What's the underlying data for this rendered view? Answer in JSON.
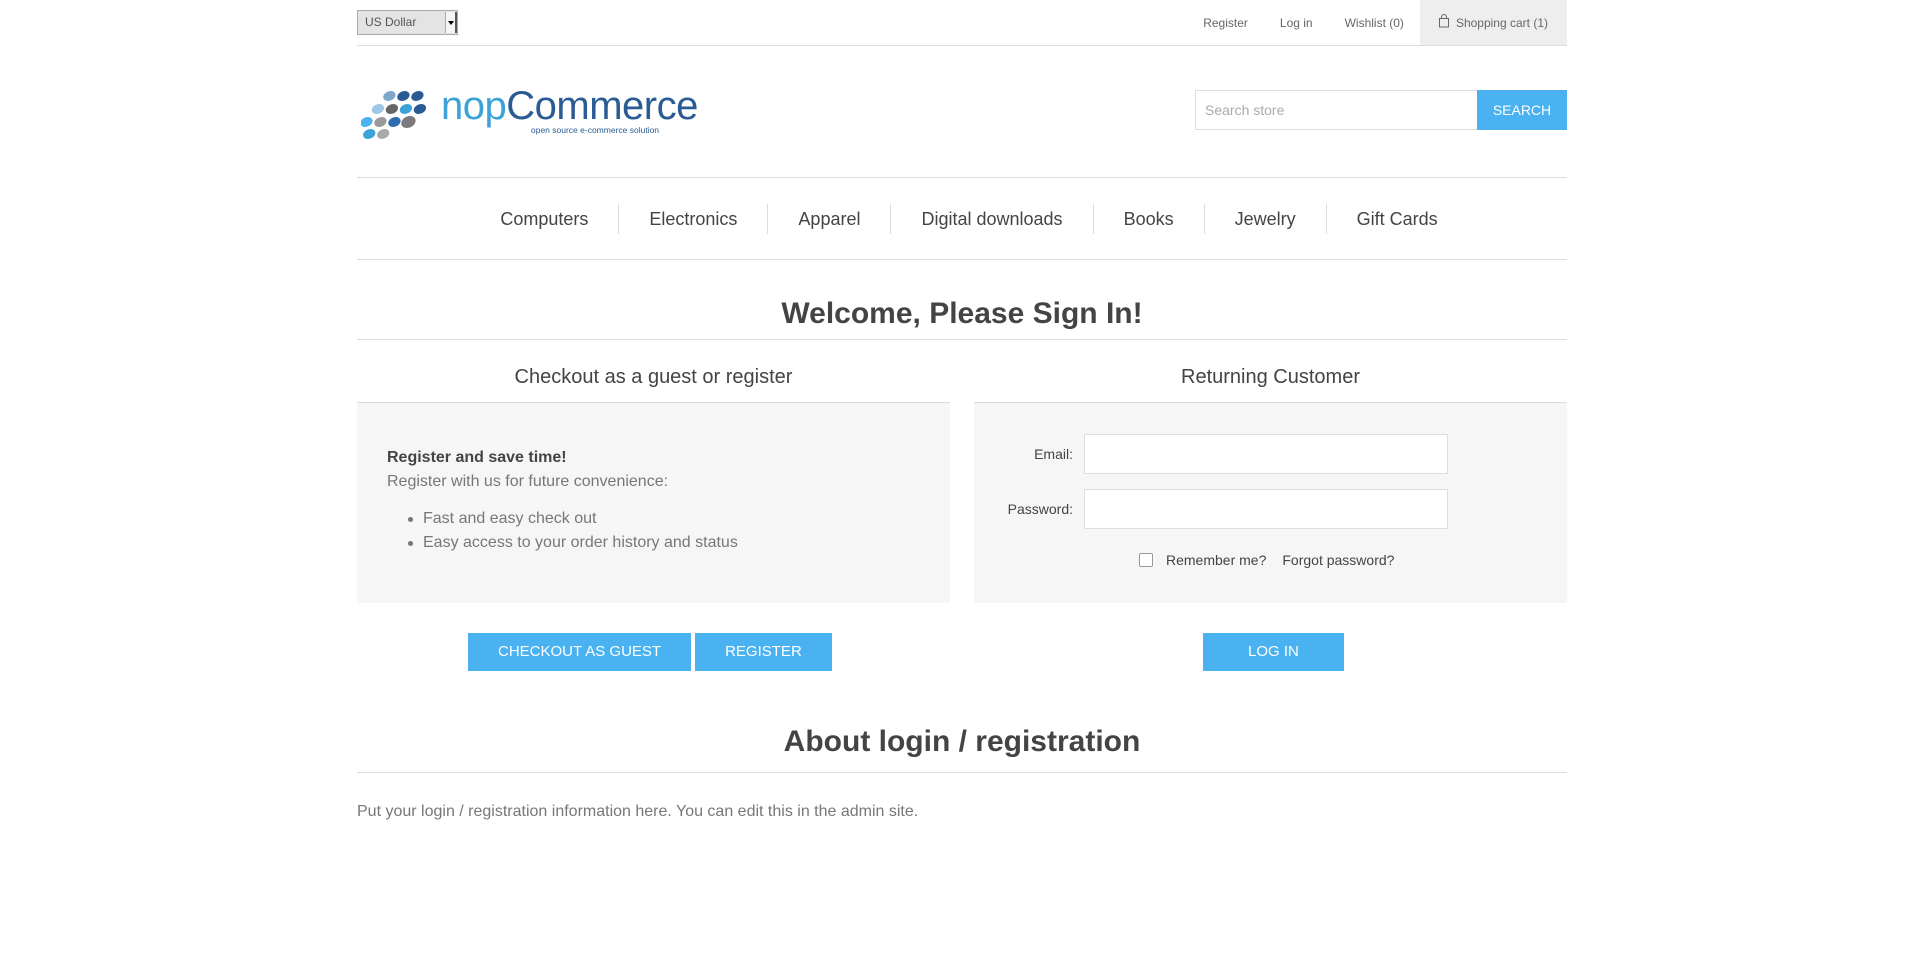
{
  "header": {
    "currency": "US Dollar",
    "links": {
      "register": "Register",
      "login": "Log in",
      "wishlist": "Wishlist (0)",
      "cart": "Shopping cart (1)"
    }
  },
  "logo": {
    "name_part1": "nop",
    "name_part2": "Commerce",
    "tagline": "open source e-commerce solution"
  },
  "search": {
    "placeholder": "Search store",
    "button": "SEARCH"
  },
  "menu": {
    "items": [
      "Computers",
      "Electronics",
      "Apparel",
      "Digital downloads",
      "Books",
      "Jewelry",
      "Gift Cards"
    ]
  },
  "page": {
    "title": "Welcome, Please Sign In!"
  },
  "guest": {
    "title": "Checkout as a guest or register",
    "strong": "Register and save time!",
    "text": "Register with us for future convenience:",
    "bullets": [
      "Fast and easy check out",
      "Easy access to your order history and status"
    ],
    "checkout_button": "CHECKOUT AS GUEST",
    "register_button": "REGISTER"
  },
  "returning": {
    "title": "Returning Customer",
    "email_label": "Email:",
    "email_value": "",
    "password_label": "Password:",
    "password_value": "",
    "remember_label": "Remember me?",
    "forgot_label": "Forgot password?",
    "login_button": "LOG IN"
  },
  "about": {
    "title": "About login / registration",
    "text": "Put your login / registration information here. You can edit this in the admin site."
  },
  "colors": {
    "accent": "#4ab2f1",
    "text": "#444444",
    "muted": "#777777",
    "border": "#dddddd",
    "panel": "#f6f6f6"
  },
  "icons": {
    "cart": "shopping-bag-icon",
    "select": "chevron-down-icon",
    "bullet": "bullet-dot-icon"
  }
}
